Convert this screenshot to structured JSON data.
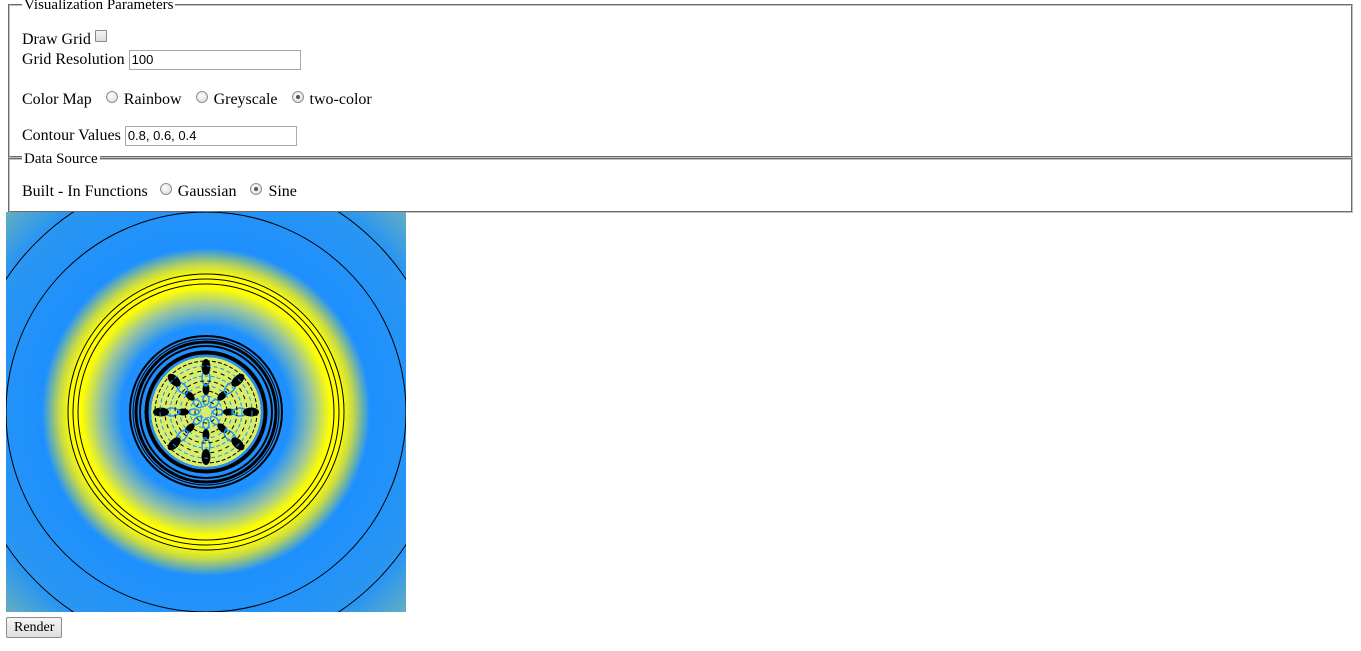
{
  "visualization": {
    "legend": "Visualization Parameters",
    "draw_grid_label": "Draw Grid",
    "draw_grid_checked": false,
    "grid_resolution_label": "Grid Resolution",
    "grid_resolution_value": "100",
    "color_map_label": "Color Map",
    "color_map_options": [
      "Rainbow",
      "Greyscale",
      "two-color"
    ],
    "color_map_selected": "two-color",
    "contour_values_label": "Contour Values",
    "contour_values_value": "0.8, 0.6, 0.4"
  },
  "data_source": {
    "legend": "Data Source",
    "builtin_label": "Built - In Functions",
    "options": [
      "Gaussian",
      "Sine"
    ],
    "selected": "Sine"
  },
  "render_button": "Render",
  "colors": {
    "low": "#1e90ff",
    "high": "#ffff00",
    "outer": "#56a8c8",
    "contour": "#000000"
  }
}
